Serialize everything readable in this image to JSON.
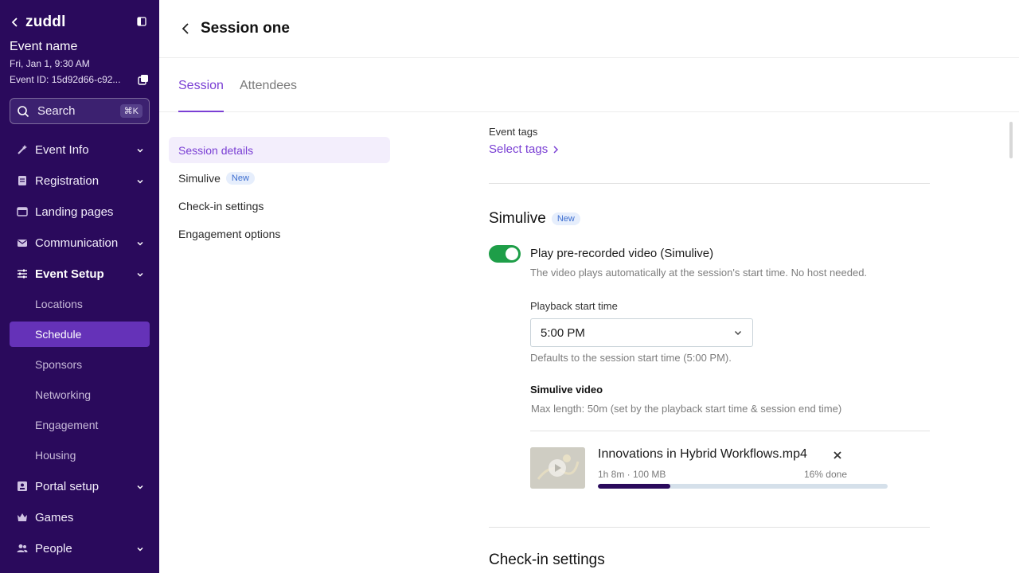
{
  "sidebar": {
    "brand": "zuddl",
    "event_name": "Event name",
    "event_date": "Fri, Jan 1, 9:30 AM",
    "event_id": "Event ID: 15d92d66-c92...",
    "search_label": "Search",
    "search_shortcut": "⌘K",
    "nav": [
      {
        "label": "Event Info"
      },
      {
        "label": "Registration"
      },
      {
        "label": "Landing pages"
      },
      {
        "label": "Communication"
      },
      {
        "label": "Event Setup"
      },
      {
        "label": "Portal setup"
      },
      {
        "label": "Games"
      },
      {
        "label": "People"
      }
    ],
    "sub_nav": [
      {
        "label": "Locations"
      },
      {
        "label": "Schedule"
      },
      {
        "label": "Sponsors"
      },
      {
        "label": "Networking"
      },
      {
        "label": "Engagement"
      },
      {
        "label": "Housing"
      }
    ]
  },
  "header": {
    "title": "Session one"
  },
  "tabs": [
    {
      "label": "Session"
    },
    {
      "label": "Attendees"
    }
  ],
  "section_nav": [
    {
      "label": "Session details"
    },
    {
      "label": "Simulive",
      "badge": "New"
    },
    {
      "label": "Check-in settings"
    },
    {
      "label": "Engagement options"
    }
  ],
  "main": {
    "event_tags_label": "Event tags",
    "select_tags_link": "Select tags",
    "simulive_title": "Simulive",
    "simulive_badge": "New",
    "toggle_label": "Play pre-recorded video (Simulive)",
    "toggle_on": true,
    "toggle_help": "The video plays automatically at the session's start time. No host needed.",
    "playback_label": "Playback start time",
    "playback_value": "5:00 PM",
    "playback_help": "Defaults to the session start time (5:00 PM).",
    "video_label": "Simulive video",
    "video_help": "Max length: 50m (set by the playback start time & session end time)",
    "file": {
      "name": "Innovations in Hybrid Workflows.mp4",
      "meta": "1h 8m · 100 MB",
      "progress_text": "16% done",
      "progress": 0.25
    },
    "checkin_title": "Check-in settings"
  },
  "colors": {
    "sidebar_bg": "#2a0a5c",
    "accent": "#7a3fd4",
    "toggle_on": "#1e9e48",
    "selected_nav": "#6532b8"
  }
}
